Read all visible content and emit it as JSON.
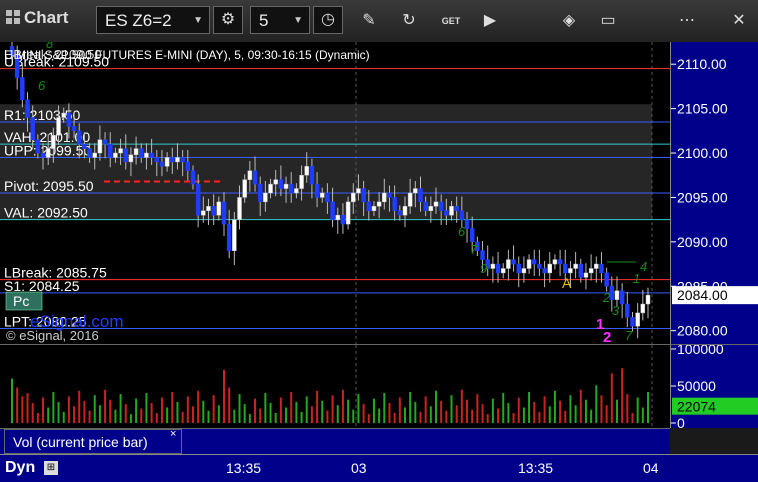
{
  "toolbar": {
    "title": "Chart",
    "symbol": "ES Z6=2",
    "interval": "5",
    "icons": [
      "settings-icon",
      "clock-icon",
      "pencil-icon",
      "refresh-icon",
      "get-icon",
      "play-icon",
      "tag-icon",
      "comment-icon",
      "more-icon",
      "close-icon"
    ],
    "get_label": "GET"
  },
  "chart_data": {
    "type": "candlestick",
    "header": "E-MINI S&P 500 FUTURES E-MINI (DAY), 5, 09:30-16:15 (Dynamic)",
    "header_overlap": "UBreak: 2109.50",
    "copyright": "© eSignal, 2016",
    "watermark": "eSignal.com",
    "ylim": [
      2078.5,
      2112.5
    ],
    "yticks": [
      "2110.00",
      "2105.00",
      "2100.00",
      "2095.00",
      "2090.00",
      "2085.00",
      "2080.00"
    ],
    "last_price": "2084.00",
    "level_lines": [
      {
        "label": "UBreak: 2109.50",
        "value": 2109.5,
        "color": "#ff3333"
      },
      {
        "label": "R1: 2103.50",
        "value": 2103.5,
        "color": "#3a5bff"
      },
      {
        "label": "VAH: 2101.00",
        "value": 2101.0,
        "color": "#33cccc"
      },
      {
        "label": "UPP: 2099.50",
        "value": 2099.5,
        "color": "#3a5bff"
      },
      {
        "label": "Pivot: 2095.50",
        "value": 2095.5,
        "color": "#3a5bff"
      },
      {
        "label": "VAL: 2092.50",
        "value": 2092.5,
        "color": "#33cccc"
      },
      {
        "label": "LBreak: 2085.75",
        "value": 2085.75,
        "color": "#ff3333"
      },
      {
        "label": "S1: 2084.25",
        "value": 2084.25,
        "color": "#3a5bff"
      },
      {
        "label": "LPT: 2080.25",
        "value": 2080.25,
        "color": "#3a5bff"
      }
    ],
    "pivot_segment": {
      "value": 2096.8,
      "color": "#ff2222"
    },
    "annotations": [
      {
        "text": "A",
        "color": "#e6c200"
      },
      {
        "text": "1",
        "color": "#ff33ff"
      },
      {
        "text": "2",
        "color": "#ff33ff"
      },
      {
        "text": "Pc",
        "color": "#ffffff"
      }
    ],
    "session_dividers": [
      "03",
      "04"
    ],
    "closes": [
      2111.0,
      2108.5,
      2106.0,
      2104.0,
      2101.5,
      2100.0,
      2099.5,
      2100.5,
      2102.0,
      2104.0,
      2104.5,
      2103.0,
      2102.5,
      2101.0,
      2100.5,
      2099.5,
      2100.0,
      2101.5,
      2101.0,
      2099.5,
      2100.0,
      2100.5,
      2099.0,
      2099.8,
      2100.5,
      2099.5,
      2100.0,
      2099.5,
      2099.0,
      2098.5,
      2099.5,
      2099.0,
      2099.5,
      2099.0,
      2098.0,
      2096.5,
      2093.0,
      2093.5,
      2094.0,
      2093.0,
      2094.5,
      2092.0,
      2089.0,
      2092.5,
      2095.0,
      2097.0,
      2098.0,
      2096.5,
      2094.5,
      2095.5,
      2096.5,
      2097.0,
      2096.0,
      2096.5,
      2095.5,
      2096.0,
      2097.5,
      2098.5,
      2096.5,
      2095.0,
      2095.5,
      2094.5,
      2092.5,
      2093.0,
      2092.0,
      2094.5,
      2095.5,
      2096.0,
      2094.5,
      2093.5,
      2094.0,
      2094.5,
      2095.5,
      2095.0,
      2093.5,
      2093.0,
      2094.0,
      2095.5,
      2096.0,
      2094.5,
      2093.5,
      2094.0,
      2094.5,
      2093.5,
      2093.0,
      2094.0,
      2093.5,
      2092.5,
      2091.5,
      2090.0,
      2089.0,
      2088.0,
      2087.0,
      2087.5,
      2086.5,
      2087.0,
      2088.0,
      2087.5,
      2086.5,
      2087.0,
      2088.0,
      2087.5,
      2087.0,
      2086.5,
      2087.5,
      2088.0,
      2087.5,
      2086.5,
      2087.0,
      2087.5,
      2086.0,
      2086.5,
      2087.0,
      2087.5,
      2086.5,
      2085.0,
      2083.5,
      2084.5,
      2083.0,
      2081.5,
      2080.5,
      2082.0,
      2083.0,
      2084.0
    ],
    "volume_ylim": [
      0,
      100000
    ],
    "volume_yticks": [
      "100000",
      "50000",
      "0"
    ],
    "volume_last": "22074",
    "volume_label": "Vol (current price bar)",
    "volume_close_glyph": "×",
    "time_labels": [
      "13:35",
      "03",
      "13:35",
      "04"
    ],
    "axis_box_label": "Dyn"
  }
}
